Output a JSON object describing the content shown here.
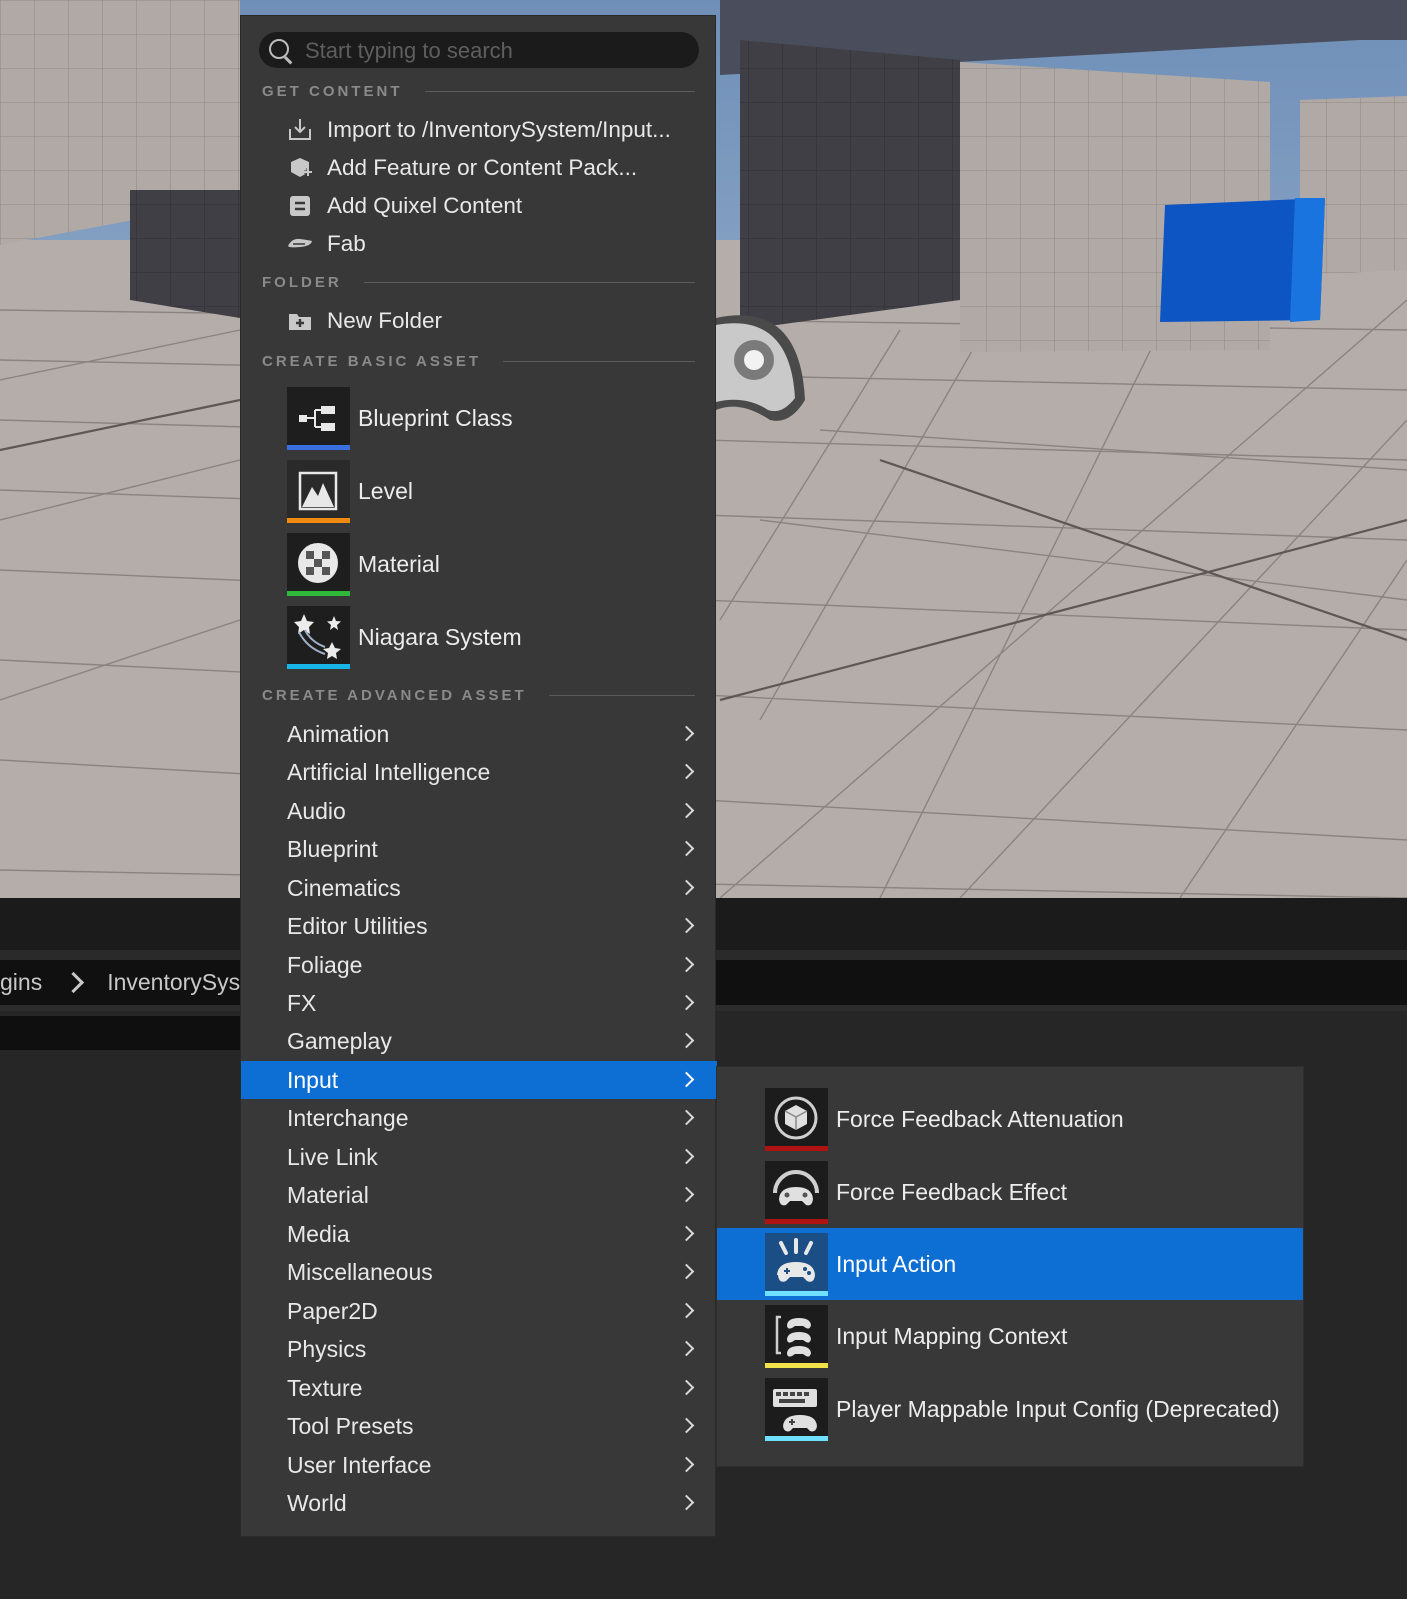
{
  "search": {
    "placeholder": "Start typing to search"
  },
  "sections": {
    "get_content": "GET CONTENT",
    "folder": "FOLDER",
    "create_basic": "CREATE BASIC ASSET",
    "create_advanced": "CREATE ADVANCED ASSET"
  },
  "get_content": [
    {
      "label": "Import to /InventorySystem/Input...",
      "icon": "import-icon"
    },
    {
      "label": "Add Feature or Content Pack...",
      "icon": "content-pack-icon"
    },
    {
      "label": "Add Quixel Content",
      "icon": "quixel-icon"
    },
    {
      "label": "Fab",
      "icon": "fab-icon"
    }
  ],
  "folder": [
    {
      "label": "New Folder",
      "icon": "new-folder-icon"
    }
  ],
  "basic_assets": [
    {
      "label": "Blueprint Class",
      "icon": "blueprint-class-icon",
      "color": "#3b6fe0"
    },
    {
      "label": "Level",
      "icon": "level-icon",
      "color": "#f08a10"
    },
    {
      "label": "Material",
      "icon": "material-icon",
      "color": "#2fb83a"
    },
    {
      "label": "Niagara System",
      "icon": "niagara-icon",
      "color": "#17b4e8"
    }
  ],
  "advanced_categories": [
    {
      "label": "Animation"
    },
    {
      "label": "Artificial Intelligence"
    },
    {
      "label": "Audio"
    },
    {
      "label": "Blueprint"
    },
    {
      "label": "Cinematics"
    },
    {
      "label": "Editor Utilities"
    },
    {
      "label": "Foliage"
    },
    {
      "label": "FX"
    },
    {
      "label": "Gameplay"
    },
    {
      "label": "Input",
      "active": true
    },
    {
      "label": "Interchange"
    },
    {
      "label": "Live Link"
    },
    {
      "label": "Material"
    },
    {
      "label": "Media"
    },
    {
      "label": "Miscellaneous"
    },
    {
      "label": "Paper2D"
    },
    {
      "label": "Physics"
    },
    {
      "label": "Texture"
    },
    {
      "label": "Tool Presets"
    },
    {
      "label": "User Interface"
    },
    {
      "label": "World"
    }
  ],
  "input_submenu": [
    {
      "label": "Force Feedback Attenuation",
      "icon": "force-feedback-attenuation-icon",
      "color": "#b01212"
    },
    {
      "label": "Force Feedback Effect",
      "icon": "force-feedback-effect-icon",
      "color": "#b01212"
    },
    {
      "label": "Input Action",
      "icon": "input-action-icon",
      "color": "#6fe0ff",
      "active": true
    },
    {
      "label": "Input Mapping Context",
      "icon": "input-mapping-context-icon",
      "color": "#f2e24a"
    },
    {
      "label": "Player Mappable Input Config (Deprecated)",
      "icon": "player-mappable-config-icon",
      "color": "#6fe0ff"
    }
  ],
  "breadcrumb": [
    "gins",
    "InventorySyst"
  ],
  "colors": {
    "accent": "#0d6fd4",
    "menu_bg": "#383838"
  }
}
